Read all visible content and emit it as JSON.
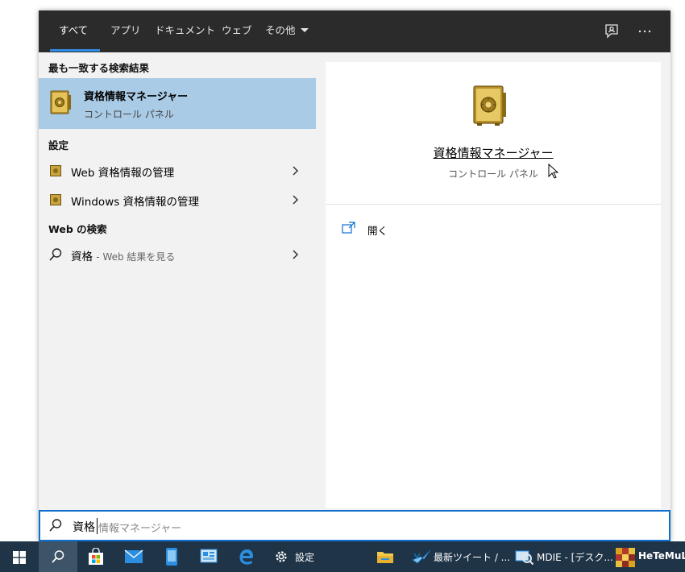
{
  "tabs": [
    {
      "label": "すべて",
      "active": true
    },
    {
      "label": "アプリ",
      "active": false
    },
    {
      "label": "ドキュメント",
      "active": false
    },
    {
      "label": "ウェブ",
      "active": false
    },
    {
      "label": "その他",
      "active": false
    }
  ],
  "sections": {
    "best_match": "最も一致する検索結果",
    "settings": "設定",
    "web_search": "Web の検索"
  },
  "best_result": {
    "title": "資格情報マネージャー",
    "subtitle": "コントロール パネル",
    "icon": "credential-manager-safe-icon"
  },
  "settings_items": [
    {
      "label": "Web 資格情報の管理"
    },
    {
      "label": "Windows 資格情報の管理"
    }
  ],
  "web_item": {
    "query": "資格",
    "hint": "- Web 結果を見る"
  },
  "preview": {
    "title": "資格情報マネージャー",
    "subtitle": "コントロール パネル",
    "open_label": "開く"
  },
  "search": {
    "typed": "資格",
    "suggestion": "情報マネージャー"
  },
  "taskbar": {
    "settings_label": "設定",
    "tweet_label": "最新ツイート / ...",
    "mdie_label": "MDIE - [デスク...",
    "hete_label": "HeTeMuLu"
  },
  "colors": {
    "accent": "#0f6fcf",
    "selected_row": "#aacbe6",
    "topbar": "#2b2b2b",
    "taskbar": "#1f3447"
  }
}
